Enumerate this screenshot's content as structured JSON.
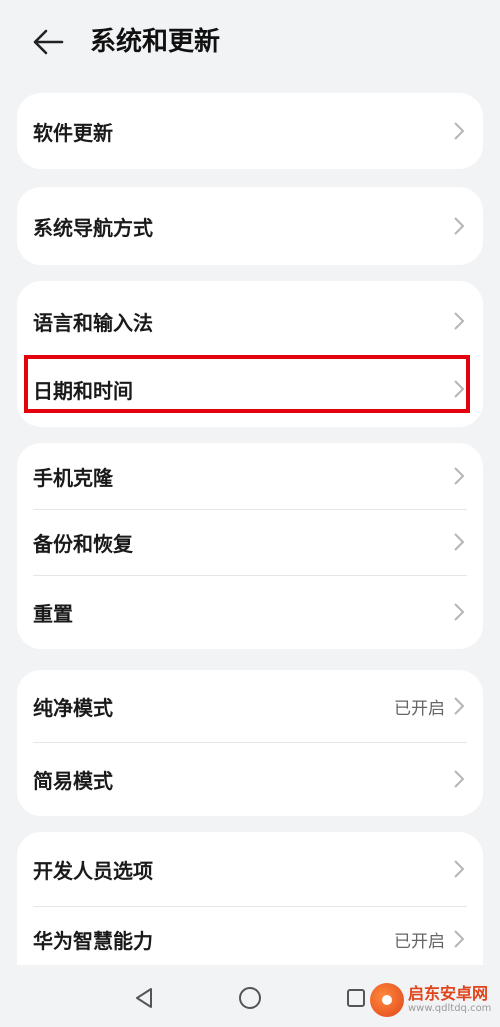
{
  "header": {
    "title": "系统和更新",
    "back_icon": "arrow-left-icon"
  },
  "groups": [
    {
      "items": [
        {
          "label": "软件更新"
        }
      ]
    },
    {
      "items": [
        {
          "label": "系统导航方式"
        }
      ]
    },
    {
      "items": [
        {
          "label": "语言和输入法"
        },
        {
          "label": "日期和时间"
        }
      ]
    },
    {
      "items": [
        {
          "label": "手机克隆"
        },
        {
          "label": "备份和恢复"
        },
        {
          "label": "重置"
        }
      ]
    },
    {
      "items": [
        {
          "label": "纯净模式",
          "value": "已开启"
        },
        {
          "label": "简易模式"
        }
      ]
    },
    {
      "items": [
        {
          "label": "开发人员选项"
        },
        {
          "label": "华为智慧能力",
          "value": "已开启"
        }
      ]
    }
  ],
  "highlight": {
    "color": "#e3000f",
    "target": "日期和时间"
  },
  "navbar": {
    "back_icon": "triangle-back-icon",
    "home_icon": "circle-home-icon",
    "recents_icon": "square-recents-icon"
  },
  "watermark": {
    "name": "启东安卓网",
    "url": "www.qdltdq.com"
  },
  "colors": {
    "background": "#f1f3f5",
    "card": "#ffffff",
    "text": "#1a1a1a",
    "secondary": "#666666"
  }
}
